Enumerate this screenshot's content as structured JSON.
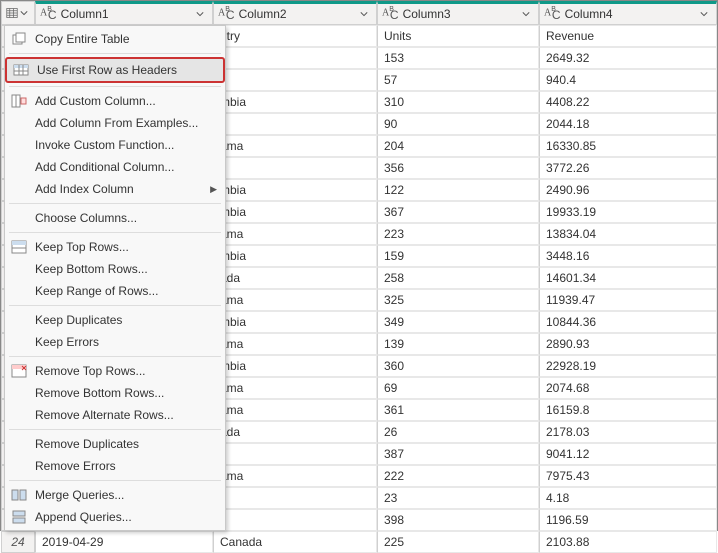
{
  "columns": [
    "Column1",
    "Column2",
    "Column3",
    "Column4"
  ],
  "rows": [
    {
      "n": "",
      "c1": "",
      "c2": "ntry",
      "c3": "Units",
      "c4": "Revenue"
    },
    {
      "n": "",
      "c1": "",
      "c2": "il",
      "c3": "153",
      "c4": "2649.32"
    },
    {
      "n": "",
      "c1": "",
      "c2": "il",
      "c3": "57",
      "c4": "940.4"
    },
    {
      "n": "",
      "c1": "",
      "c2": "mbia",
      "c3": "310",
      "c4": "4408.22"
    },
    {
      "n": "",
      "c1": "",
      "c2": "il",
      "c3": "90",
      "c4": "2044.18"
    },
    {
      "n": "",
      "c1": "",
      "c2": "ama",
      "c3": "204",
      "c4": "16330.85"
    },
    {
      "n": "",
      "c1": "",
      "c2": "il",
      "c3": "356",
      "c4": "3772.26"
    },
    {
      "n": "",
      "c1": "",
      "c2": "mbia",
      "c3": "122",
      "c4": "2490.96"
    },
    {
      "n": "",
      "c1": "",
      "c2": "mbia",
      "c3": "367",
      "c4": "19933.19"
    },
    {
      "n": "",
      "c1": "",
      "c2": "ama",
      "c3": "223",
      "c4": "13834.04"
    },
    {
      "n": "",
      "c1": "",
      "c2": "mbia",
      "c3": "159",
      "c4": "3448.16"
    },
    {
      "n": "",
      "c1": "",
      "c2": "ada",
      "c3": "258",
      "c4": "14601.34"
    },
    {
      "n": "",
      "c1": "",
      "c2": "ama",
      "c3": "325",
      "c4": "11939.47"
    },
    {
      "n": "",
      "c1": "",
      "c2": "mbia",
      "c3": "349",
      "c4": "10844.36"
    },
    {
      "n": "",
      "c1": "",
      "c2": "ama",
      "c3": "139",
      "c4": "2890.93"
    },
    {
      "n": "",
      "c1": "",
      "c2": "mbia",
      "c3": "360",
      "c4": "22928.19"
    },
    {
      "n": "",
      "c1": "",
      "c2": "ama",
      "c3": "69",
      "c4": "2074.68"
    },
    {
      "n": "",
      "c1": "",
      "c2": "ama",
      "c3": "361",
      "c4": "16159.8"
    },
    {
      "n": "",
      "c1": "",
      "c2": "ada",
      "c3": "26",
      "c4": "2178.03"
    },
    {
      "n": "",
      "c1": "",
      "c2": "il",
      "c3": "387",
      "c4": "9041.12"
    },
    {
      "n": "",
      "c1": "",
      "c2": "ama",
      "c3": "222",
      "c4": "7975.43"
    },
    {
      "n": "",
      "c1": "",
      "c2": "il",
      "c3": "23",
      "c4": "4.18"
    },
    {
      "n": "",
      "c1": "",
      "c2": "il",
      "c3": "398",
      "c4": "1196.59"
    },
    {
      "n": "24",
      "c1": "2019-04-29",
      "c2": "Canada",
      "c3": "225",
      "c4": "2103.88"
    }
  ],
  "menu": {
    "groups": [
      [
        {
          "label": "Copy Entire Table",
          "icon": "copy"
        }
      ],
      [
        {
          "label": "Use First Row as Headers",
          "icon": "headers",
          "highlighted": true
        }
      ],
      [
        {
          "label": "Add Custom Column...",
          "icon": "addcol"
        },
        {
          "label": "Add Column From Examples..."
        },
        {
          "label": "Invoke Custom Function..."
        },
        {
          "label": "Add Conditional Column..."
        },
        {
          "label": "Add Index Column",
          "submenu": true
        }
      ],
      [
        {
          "label": "Choose Columns..."
        }
      ],
      [
        {
          "label": "Keep Top Rows...",
          "icon": "keeprows"
        },
        {
          "label": "Keep Bottom Rows..."
        },
        {
          "label": "Keep Range of Rows..."
        }
      ],
      [
        {
          "label": "Keep Duplicates"
        },
        {
          "label": "Keep Errors"
        }
      ],
      [
        {
          "label": "Remove Top Rows...",
          "icon": "removerows"
        },
        {
          "label": "Remove Bottom Rows..."
        },
        {
          "label": "Remove Alternate Rows..."
        }
      ],
      [
        {
          "label": "Remove Duplicates"
        },
        {
          "label": "Remove Errors"
        }
      ],
      [
        {
          "label": "Merge Queries...",
          "icon": "merge"
        },
        {
          "label": "Append Queries...",
          "icon": "append"
        }
      ]
    ]
  }
}
